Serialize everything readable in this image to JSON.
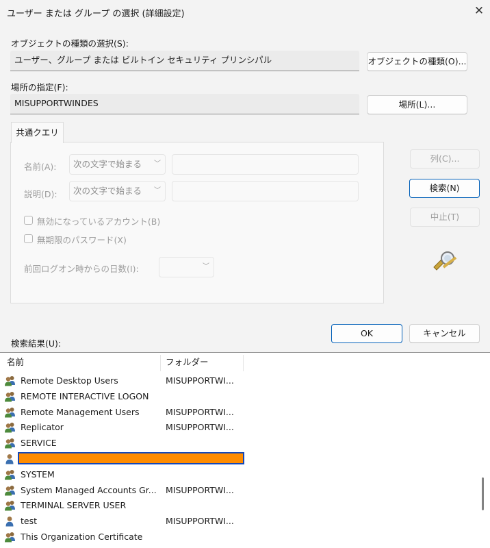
{
  "window": {
    "title": "ユーザー または グループ の選択 (詳細設定)"
  },
  "object_type": {
    "label": "オブジェクトの種類の選択(S):",
    "value": "ユーザー、グループ または ビルトイン セキュリティ プリンシパル",
    "button": "オブジェクトの種類(O)..."
  },
  "location": {
    "label": "場所の指定(F):",
    "value": "MISUPPORTWINDES",
    "button": "場所(L)..."
  },
  "query": {
    "tab": "共通クエリ",
    "name_label": "名前(A):",
    "name_mode": "次の文字で始まる",
    "desc_label": "説明(D):",
    "desc_mode": "次の文字で始まる",
    "disabled_accounts": "無効になっているアカウント(B)",
    "non_expiring_pw": "無期限のパスワード(X)",
    "days_label": "前回ログオン時からの日数(I):",
    "days_value": ""
  },
  "buttons": {
    "columns": "列(C)...",
    "search": "検索(N)",
    "stop": "中止(T)",
    "ok": "OK",
    "cancel": "キャンセル"
  },
  "results": {
    "label": "検索結果(U):",
    "col_name": "名前",
    "col_folder": "フォルダー",
    "rows": [
      {
        "name": "Remote Desktop Users",
        "folder": "MISUPPORTWI...",
        "icon": "group-icon"
      },
      {
        "name": "REMOTE INTERACTIVE LOGON",
        "folder": "",
        "icon": "group-icon"
      },
      {
        "name": "Remote Management Users",
        "folder": "MISUPPORTWI...",
        "icon": "group-icon"
      },
      {
        "name": "Replicator",
        "folder": "MISUPPORTWI...",
        "icon": "group-icon"
      },
      {
        "name": "SERVICE",
        "folder": "",
        "icon": "group-icon"
      },
      {
        "name": "",
        "folder": "",
        "icon": "user-icon",
        "selected": true
      },
      {
        "name": "SYSTEM",
        "folder": "",
        "icon": "group-icon"
      },
      {
        "name": "System Managed Accounts Gr...",
        "folder": "MISUPPORTWI...",
        "icon": "group-icon"
      },
      {
        "name": "TERMINAL SERVER USER",
        "folder": "",
        "icon": "group-icon"
      },
      {
        "name": "test",
        "folder": "MISUPPORTWI...",
        "icon": "user-icon"
      },
      {
        "name": "This Organization Certificate",
        "folder": "",
        "icon": "group-icon"
      }
    ]
  },
  "colors": {
    "accent": "#005fb8",
    "selection_fill": "#ff8c00",
    "selection_border": "#1448b8"
  }
}
